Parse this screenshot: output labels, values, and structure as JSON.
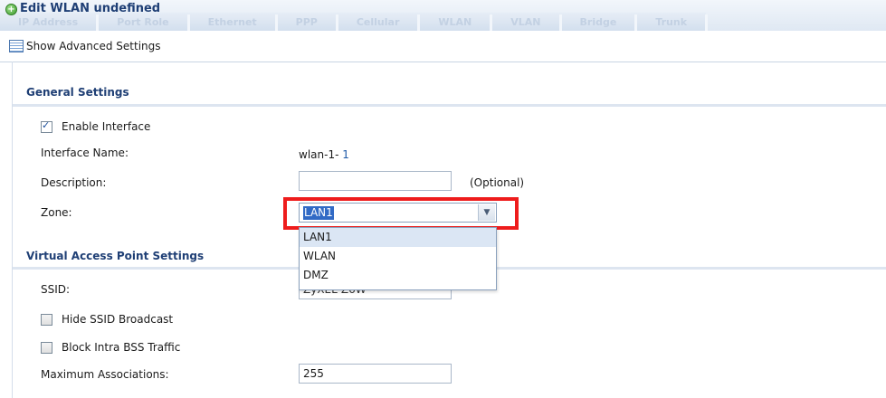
{
  "window": {
    "title": "Edit WLAN undefined",
    "background_tabs": [
      "IP Address",
      "Port Role",
      "Ethernet",
      "PPP",
      "Cellular",
      "WLAN",
      "VLAN",
      "Bridge",
      "Trunk"
    ]
  },
  "toolbar": {
    "advanced_label": "Show Advanced Settings"
  },
  "general": {
    "section_title": "General Settings",
    "enable_interface_label": "Enable Interface",
    "enable_interface_checked": true,
    "interface_name_label": "Interface Name:",
    "interface_name_prefix": "wlan-1-",
    "interface_name_suffix": "1",
    "description_label": "Description:",
    "description_value": "",
    "description_hint": "(Optional)",
    "zone_label": "Zone:",
    "zone_selected": "LAN1",
    "zone_options": [
      "LAN1",
      "WLAN",
      "DMZ"
    ]
  },
  "vap": {
    "section_title": "Virtual Access Point Settings",
    "ssid_label": "SSID:",
    "ssid_value": "ZyXEL-Z6W",
    "hide_ssid_label": "Hide SSID Broadcast",
    "hide_ssid_checked": false,
    "block_intra_label": "Block Intra BSS Traffic",
    "block_intra_checked": false,
    "max_assoc_label": "Maximum Associations:",
    "max_assoc_value": "255"
  },
  "colors": {
    "section_title": "#1f3f75",
    "highlight": "#ee1c1c",
    "selection": "#316ac5"
  }
}
